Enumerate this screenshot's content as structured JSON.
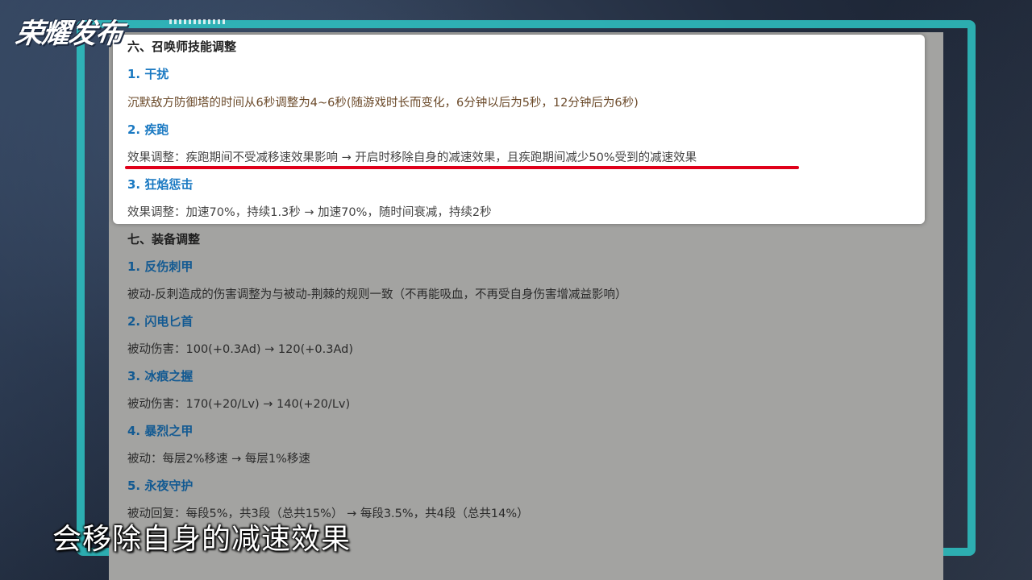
{
  "logo": {
    "text": "荣耀发布"
  },
  "highlight": {
    "section_title": "六、召唤师技能调整",
    "items": [
      {
        "title": "1. 干扰",
        "desc": "沉默敌方防御塔的时间从6秒调整为4~6秒(随游戏时长而变化，6分钟以后为5秒，12分钟后为6秒)"
      },
      {
        "title": "2. 疾跑",
        "desc": "效果调整：疾跑期间不受减移速效果影响 → 开启时移除自身的减速效果，且疾跑期间减少50%受到的减速效果"
      },
      {
        "title": "3. 狂焰惩击",
        "desc": "效果调整：加速70%，持续1.3秒 → 加速70%，随时间衰减，持续2秒"
      }
    ]
  },
  "doc": {
    "section_title": "七、装备调整",
    "items": [
      {
        "title": "1. 反伤刺甲",
        "desc": "被动-反刺造成的伤害调整为与被动-荆棘的规则一致（不再能吸血，不再受自身伤害增减益影响）"
      },
      {
        "title": "2. 闪电匕首",
        "desc": "被动伤害：100(+0.3Ad) → 120(+0.3Ad)"
      },
      {
        "title": "3. 冰痕之握",
        "desc": "被动伤害：170(+20/Lv) → 140(+20/Lv)"
      },
      {
        "title": "4. 暴烈之甲",
        "desc": "被动：每层2%移速 → 每层1%移速"
      },
      {
        "title": "5. 永夜守护",
        "desc": "被动回复：每段5%，共3段（总共15%） → 每段3.5%，共4段（总共14%）"
      }
    ]
  },
  "subtitle": "会移除自身的减速效果",
  "colors": {
    "accent_blue": "#1a79c2",
    "underline_red": "#e0001a",
    "frame_teal": "#2ec4c4"
  }
}
